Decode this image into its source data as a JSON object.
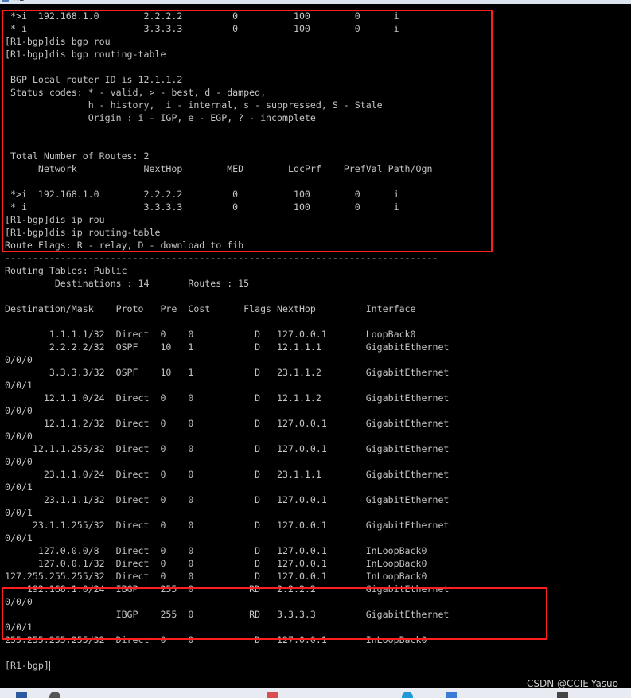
{
  "window": {
    "title": "R1"
  },
  "terminal": {
    "lines": [
      " *>i  192.168.1.0        2.2.2.2         0          100        0      i",
      " * i                     3.3.3.3         0          100        0      i",
      "[R1-bgp]dis bgp rou",
      "[R1-bgp]dis bgp routing-table",
      "",
      " BGP Local router ID is 12.1.1.2",
      " Status codes: * - valid, > - best, d - damped,",
      "               h - history,  i - internal, s - suppressed, S - Stale",
      "               Origin : i - IGP, e - EGP, ? - incomplete",
      "",
      "",
      " Total Number of Routes: 2",
      "      Network            NextHop        MED        LocPrf    PrefVal Path/Ogn",
      "",
      " *>i  192.168.1.0        2.2.2.2         0          100        0      i",
      " * i                     3.3.3.3         0          100        0      i",
      "[R1-bgp]dis ip rou",
      "[R1-bgp]dis ip routing-table",
      "Route Flags: R - relay, D - download to fib",
      "------------------------------------------------------------------------------",
      "Routing Tables: Public",
      "         Destinations : 14       Routes : 15",
      "",
      "Destination/Mask    Proto   Pre  Cost      Flags NextHop         Interface",
      "",
      "        1.1.1.1/32  Direct  0    0           D   127.0.0.1       LoopBack0",
      "        2.2.2.2/32  OSPF    10   1           D   12.1.1.1        GigabitEthernet",
      "0/0/0",
      "        3.3.3.3/32  OSPF    10   1           D   23.1.1.2        GigabitEthernet",
      "0/0/1",
      "       12.1.1.0/24  Direct  0    0           D   12.1.1.2        GigabitEthernet",
      "0/0/0",
      "       12.1.1.2/32  Direct  0    0           D   127.0.0.1       GigabitEthernet",
      "0/0/0",
      "     12.1.1.255/32  Direct  0    0           D   127.0.0.1       GigabitEthernet",
      "0/0/0",
      "       23.1.1.0/24  Direct  0    0           D   23.1.1.1        GigabitEthernet",
      "0/0/1",
      "       23.1.1.1/32  Direct  0    0           D   127.0.0.1       GigabitEthernet",
      "0/0/1",
      "     23.1.1.255/32  Direct  0    0           D   127.0.0.1       GigabitEthernet",
      "0/0/1",
      "      127.0.0.0/8   Direct  0    0           D   127.0.0.1       InLoopBack0",
      "      127.0.0.1/32  Direct  0    0           D   127.0.0.1       InLoopBack0",
      "127.255.255.255/32  Direct  0    0           D   127.0.0.1       InLoopBack0",
      "    192.168.1.0/24  IBGP    255  0          RD   2.2.2.2         GigabitEthernet",
      "0/0/0",
      "                    IBGP    255  0          RD   3.3.3.3         GigabitEthernet",
      "0/0/1",
      "255.255.255.255/32  Direct  0    0           D   127.0.0.1       InLoopBack0",
      "",
      "[R1-bgp]"
    ]
  },
  "watermark": "CSDN @CCIE-Yasuo",
  "colors": {
    "text": "#c4c4c4",
    "background": "#000000",
    "highlight": "#ff1e1e"
  },
  "taskbar": {
    "icons": [
      "start-icon",
      "search-icon",
      "app-icon",
      "edge-icon",
      "store-icon",
      "terminal-icon"
    ]
  }
}
